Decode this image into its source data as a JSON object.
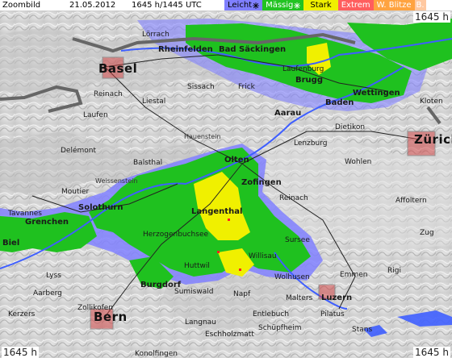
{
  "header": {
    "title": "Zoombild",
    "date": "21.05.2012",
    "time": "1645 h/1445 UTC"
  },
  "legend": [
    {
      "label": "Leicht",
      "color": "#7f7fff",
      "text_color": "#000000",
      "icon": "snowflake-icon"
    },
    {
      "label": "Mässig",
      "color": "#22c322",
      "text_color": "#ffffff",
      "icon": "snowflake-icon"
    },
    {
      "label": "Stark",
      "color": "#f0f000",
      "text_color": "#000000"
    },
    {
      "label": "Extrem",
      "color": "#ff5e5e",
      "text_color": "#ffffff"
    },
    {
      "label": "W. Blitze",
      "color": "#ffa340",
      "text_color": "#ffffff"
    },
    {
      "label": "B.",
      "color": "#ffc8a0",
      "text_color": "#ffffff"
    }
  ],
  "corners": {
    "top_right": "1645 h",
    "bottom_left": "1645 h",
    "bottom_right": "1645 h"
  },
  "places": [
    {
      "name": "Basel",
      "cls": "big"
    },
    {
      "name": "Rheinfelden",
      "cls": "medium"
    },
    {
      "name": "Bad Säckingen",
      "cls": "medium"
    },
    {
      "name": "Brugg",
      "cls": "medium"
    },
    {
      "name": "Wettingen",
      "cls": "medium"
    },
    {
      "name": "Baden",
      "cls": "medium"
    },
    {
      "name": "Zürich",
      "cls": "big"
    },
    {
      "name": "Aarau",
      "cls": "medium"
    },
    {
      "name": "Olten",
      "cls": "medium"
    },
    {
      "name": "Zofingen",
      "cls": "medium"
    },
    {
      "name": "Langenthal",
      "cls": "medium"
    },
    {
      "name": "Solothurn",
      "cls": "medium"
    },
    {
      "name": "Grenchen",
      "cls": "medium"
    },
    {
      "name": "Biel",
      "cls": "medium"
    },
    {
      "name": "Burgdorf",
      "cls": "medium"
    },
    {
      "name": "Bern",
      "cls": "big"
    },
    {
      "name": "Luzern",
      "cls": "medium"
    },
    {
      "name": "Delémont",
      "cls": ""
    },
    {
      "name": "Liestal",
      "cls": ""
    },
    {
      "name": "Lörrach",
      "cls": ""
    },
    {
      "name": "Frick",
      "cls": ""
    },
    {
      "name": "Lenzburg",
      "cls": ""
    },
    {
      "name": "Dietikon",
      "cls": ""
    },
    {
      "name": "Kloten",
      "cls": ""
    },
    {
      "name": "Huttwil",
      "cls": ""
    },
    {
      "name": "Willisau",
      "cls": ""
    },
    {
      "name": "Wolhusen",
      "cls": ""
    },
    {
      "name": "Sursee",
      "cls": ""
    },
    {
      "name": "Reinach",
      "cls": ""
    },
    {
      "name": "Wohlen",
      "cls": ""
    },
    {
      "name": "Zug",
      "cls": ""
    },
    {
      "name": "Emmen",
      "cls": ""
    },
    {
      "name": "Malters",
      "cls": ""
    },
    {
      "name": "Herzogenbuchsee",
      "cls": ""
    },
    {
      "name": "Balsthal",
      "cls": ""
    },
    {
      "name": "Moutier",
      "cls": ""
    },
    {
      "name": "Laufen",
      "cls": ""
    },
    {
      "name": "Reinach",
      "cls": ""
    },
    {
      "name": "Sissach",
      "cls": ""
    },
    {
      "name": "Laufenburg",
      "cls": ""
    },
    {
      "name": "Tavannes",
      "cls": ""
    },
    {
      "name": "Lyss",
      "cls": ""
    },
    {
      "name": "Aarberg",
      "cls": ""
    },
    {
      "name": "Zollikofen",
      "cls": ""
    },
    {
      "name": "Kerzers",
      "cls": ""
    },
    {
      "name": "Langnau",
      "cls": ""
    },
    {
      "name": "Entlebuch",
      "cls": ""
    },
    {
      "name": "Schüpfheim",
      "cls": ""
    },
    {
      "name": "Eschholzmatt",
      "cls": ""
    },
    {
      "name": "Sumiswald",
      "cls": ""
    },
    {
      "name": "Napf",
      "cls": ""
    },
    {
      "name": "Pilatus",
      "cls": ""
    },
    {
      "name": "Stans",
      "cls": ""
    },
    {
      "name": "Affoltern",
      "cls": ""
    },
    {
      "name": "Weissenstein",
      "cls": ""
    },
    {
      "name": "Hauenstein",
      "cls": ""
    },
    {
      "name": "Rigi",
      "cls": ""
    },
    {
      "name": "Konolfingen",
      "cls": ""
    }
  ]
}
